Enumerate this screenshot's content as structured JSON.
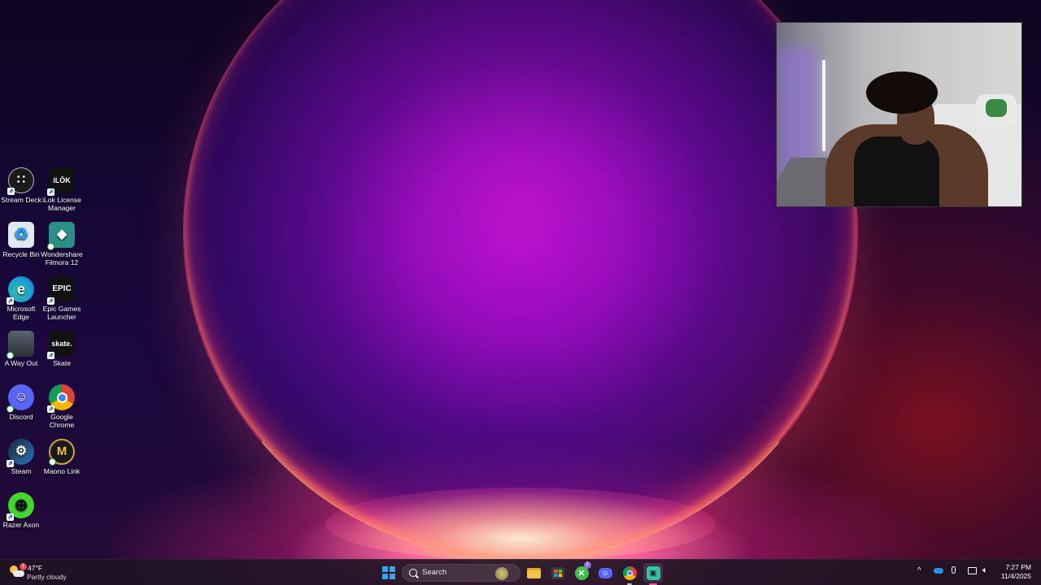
{
  "desktop": {
    "icons": [
      {
        "label": "Stream Deck",
        "icon": "stream-deck-icon",
        "color": "#ffffff",
        "bg": "#1b1b1b",
        "glyph": "∷"
      },
      {
        "label": "iLok License Manager",
        "icon": "ilok-icon",
        "color": "#ffffff",
        "bg": "#111111",
        "glyph": "iLŌK"
      },
      {
        "label": "Recycle Bin",
        "icon": "recycle-bin-icon",
        "color": "#2a9df4",
        "bg": "#dfe9f3",
        "glyph": "♻"
      },
      {
        "label": "Wondershare Filmora 12",
        "icon": "filmora-icon",
        "color": "#ffffff",
        "bg": "#2a8f86",
        "glyph": "◆"
      },
      {
        "label": "Microsoft Edge",
        "icon": "edge-icon",
        "color": "#ffffff",
        "bg": "#1d9fd8",
        "glyph": "e"
      },
      {
        "label": "Epic Games Launcher",
        "icon": "epic-games-icon",
        "color": "#ffffff",
        "bg": "#111111",
        "glyph": "EPIC"
      },
      {
        "label": "A Way Out",
        "icon": "a-way-out-icon",
        "color": "#ffffff",
        "bg": "#3a4048",
        "glyph": ""
      },
      {
        "label": "Skate",
        "icon": "skate-icon",
        "color": "#ffffff",
        "bg": "#111111",
        "glyph": "skate."
      },
      {
        "label": "Discord",
        "icon": "discord-icon",
        "color": "#ffffff",
        "bg": "#5865f2",
        "glyph": "☺"
      },
      {
        "label": "Google Chrome",
        "icon": "chrome-icon",
        "color": "#ffffff",
        "bg": "#db4437",
        "glyph": "●"
      },
      {
        "label": "Steam",
        "icon": "steam-icon",
        "color": "#ffffff",
        "bg": "#1b2838",
        "glyph": "⚙"
      },
      {
        "label": "Maono Link",
        "icon": "maono-link-icon",
        "color": "#f5c542",
        "bg": "#1a1a1a",
        "glyph": "M"
      },
      {
        "label": "Razer Axon",
        "icon": "razer-axon-icon",
        "color": "#0b0b0b",
        "bg": "#44d62c",
        "glyph": "⊕"
      }
    ]
  },
  "taskbar": {
    "weather": {
      "temp": "47°F",
      "desc": "Partly cloudy",
      "badge": "1"
    },
    "search": {
      "label": "Search"
    },
    "apps": [
      {
        "name": "file-explorer-icon",
        "color": "#f3c24a"
      },
      {
        "name": "microsoft-store-icon",
        "color": "#3aa0f0"
      },
      {
        "name": "xbox-icon",
        "color": "#3fbf4a",
        "badge": "1"
      },
      {
        "name": "discord-taskbar-icon",
        "color": "#5865f2"
      },
      {
        "name": "chrome-taskbar-icon",
        "color": "#db4437"
      },
      {
        "name": "active-app-icon",
        "color": "#2ec4a5"
      }
    ],
    "tray": {
      "chevron": "^",
      "clock_time": "7:27 PM",
      "clock_date": "11/4/2025"
    }
  },
  "colors": {
    "accent": "#3aa0f0",
    "taskbar_bg": "#201424"
  }
}
